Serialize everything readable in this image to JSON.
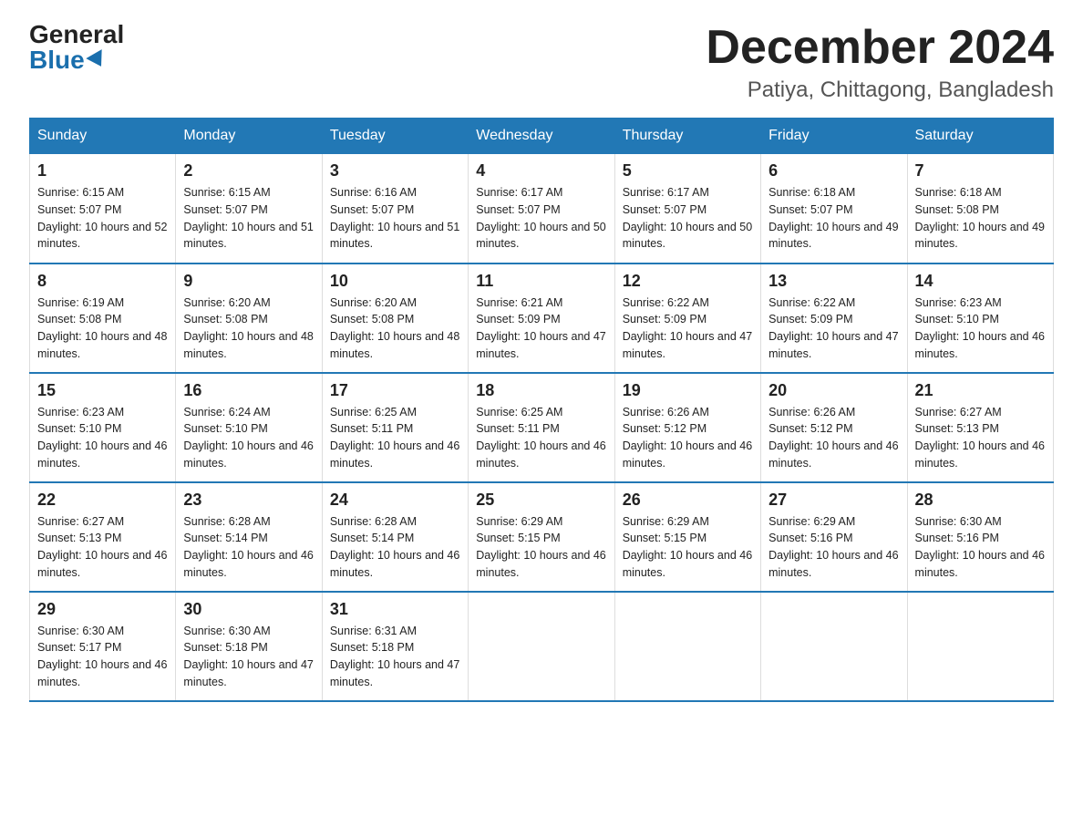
{
  "logo": {
    "general": "General",
    "blue": "Blue"
  },
  "header": {
    "month": "December 2024",
    "location": "Patiya, Chittagong, Bangladesh"
  },
  "days_of_week": [
    "Sunday",
    "Monday",
    "Tuesday",
    "Wednesday",
    "Thursday",
    "Friday",
    "Saturday"
  ],
  "weeks": [
    [
      {
        "day": "1",
        "sunrise": "6:15 AM",
        "sunset": "5:07 PM",
        "daylight": "10 hours and 52 minutes."
      },
      {
        "day": "2",
        "sunrise": "6:15 AM",
        "sunset": "5:07 PM",
        "daylight": "10 hours and 51 minutes."
      },
      {
        "day": "3",
        "sunrise": "6:16 AM",
        "sunset": "5:07 PM",
        "daylight": "10 hours and 51 minutes."
      },
      {
        "day": "4",
        "sunrise": "6:17 AM",
        "sunset": "5:07 PM",
        "daylight": "10 hours and 50 minutes."
      },
      {
        "day": "5",
        "sunrise": "6:17 AM",
        "sunset": "5:07 PM",
        "daylight": "10 hours and 50 minutes."
      },
      {
        "day": "6",
        "sunrise": "6:18 AM",
        "sunset": "5:07 PM",
        "daylight": "10 hours and 49 minutes."
      },
      {
        "day": "7",
        "sunrise": "6:18 AM",
        "sunset": "5:08 PM",
        "daylight": "10 hours and 49 minutes."
      }
    ],
    [
      {
        "day": "8",
        "sunrise": "6:19 AM",
        "sunset": "5:08 PM",
        "daylight": "10 hours and 48 minutes."
      },
      {
        "day": "9",
        "sunrise": "6:20 AM",
        "sunset": "5:08 PM",
        "daylight": "10 hours and 48 minutes."
      },
      {
        "day": "10",
        "sunrise": "6:20 AM",
        "sunset": "5:08 PM",
        "daylight": "10 hours and 48 minutes."
      },
      {
        "day": "11",
        "sunrise": "6:21 AM",
        "sunset": "5:09 PM",
        "daylight": "10 hours and 47 minutes."
      },
      {
        "day": "12",
        "sunrise": "6:22 AM",
        "sunset": "5:09 PM",
        "daylight": "10 hours and 47 minutes."
      },
      {
        "day": "13",
        "sunrise": "6:22 AM",
        "sunset": "5:09 PM",
        "daylight": "10 hours and 47 minutes."
      },
      {
        "day": "14",
        "sunrise": "6:23 AM",
        "sunset": "5:10 PM",
        "daylight": "10 hours and 46 minutes."
      }
    ],
    [
      {
        "day": "15",
        "sunrise": "6:23 AM",
        "sunset": "5:10 PM",
        "daylight": "10 hours and 46 minutes."
      },
      {
        "day": "16",
        "sunrise": "6:24 AM",
        "sunset": "5:10 PM",
        "daylight": "10 hours and 46 minutes."
      },
      {
        "day": "17",
        "sunrise": "6:25 AM",
        "sunset": "5:11 PM",
        "daylight": "10 hours and 46 minutes."
      },
      {
        "day": "18",
        "sunrise": "6:25 AM",
        "sunset": "5:11 PM",
        "daylight": "10 hours and 46 minutes."
      },
      {
        "day": "19",
        "sunrise": "6:26 AM",
        "sunset": "5:12 PM",
        "daylight": "10 hours and 46 minutes."
      },
      {
        "day": "20",
        "sunrise": "6:26 AM",
        "sunset": "5:12 PM",
        "daylight": "10 hours and 46 minutes."
      },
      {
        "day": "21",
        "sunrise": "6:27 AM",
        "sunset": "5:13 PM",
        "daylight": "10 hours and 46 minutes."
      }
    ],
    [
      {
        "day": "22",
        "sunrise": "6:27 AM",
        "sunset": "5:13 PM",
        "daylight": "10 hours and 46 minutes."
      },
      {
        "day": "23",
        "sunrise": "6:28 AM",
        "sunset": "5:14 PM",
        "daylight": "10 hours and 46 minutes."
      },
      {
        "day": "24",
        "sunrise": "6:28 AM",
        "sunset": "5:14 PM",
        "daylight": "10 hours and 46 minutes."
      },
      {
        "day": "25",
        "sunrise": "6:29 AM",
        "sunset": "5:15 PM",
        "daylight": "10 hours and 46 minutes."
      },
      {
        "day": "26",
        "sunrise": "6:29 AM",
        "sunset": "5:15 PM",
        "daylight": "10 hours and 46 minutes."
      },
      {
        "day": "27",
        "sunrise": "6:29 AM",
        "sunset": "5:16 PM",
        "daylight": "10 hours and 46 minutes."
      },
      {
        "day": "28",
        "sunrise": "6:30 AM",
        "sunset": "5:16 PM",
        "daylight": "10 hours and 46 minutes."
      }
    ],
    [
      {
        "day": "29",
        "sunrise": "6:30 AM",
        "sunset": "5:17 PM",
        "daylight": "10 hours and 46 minutes."
      },
      {
        "day": "30",
        "sunrise": "6:30 AM",
        "sunset": "5:18 PM",
        "daylight": "10 hours and 47 minutes."
      },
      {
        "day": "31",
        "sunrise": "6:31 AM",
        "sunset": "5:18 PM",
        "daylight": "10 hours and 47 minutes."
      },
      {
        "day": "",
        "sunrise": "",
        "sunset": "",
        "daylight": ""
      },
      {
        "day": "",
        "sunrise": "",
        "sunset": "",
        "daylight": ""
      },
      {
        "day": "",
        "sunrise": "",
        "sunset": "",
        "daylight": ""
      },
      {
        "day": "",
        "sunrise": "",
        "sunset": "",
        "daylight": ""
      }
    ]
  ]
}
